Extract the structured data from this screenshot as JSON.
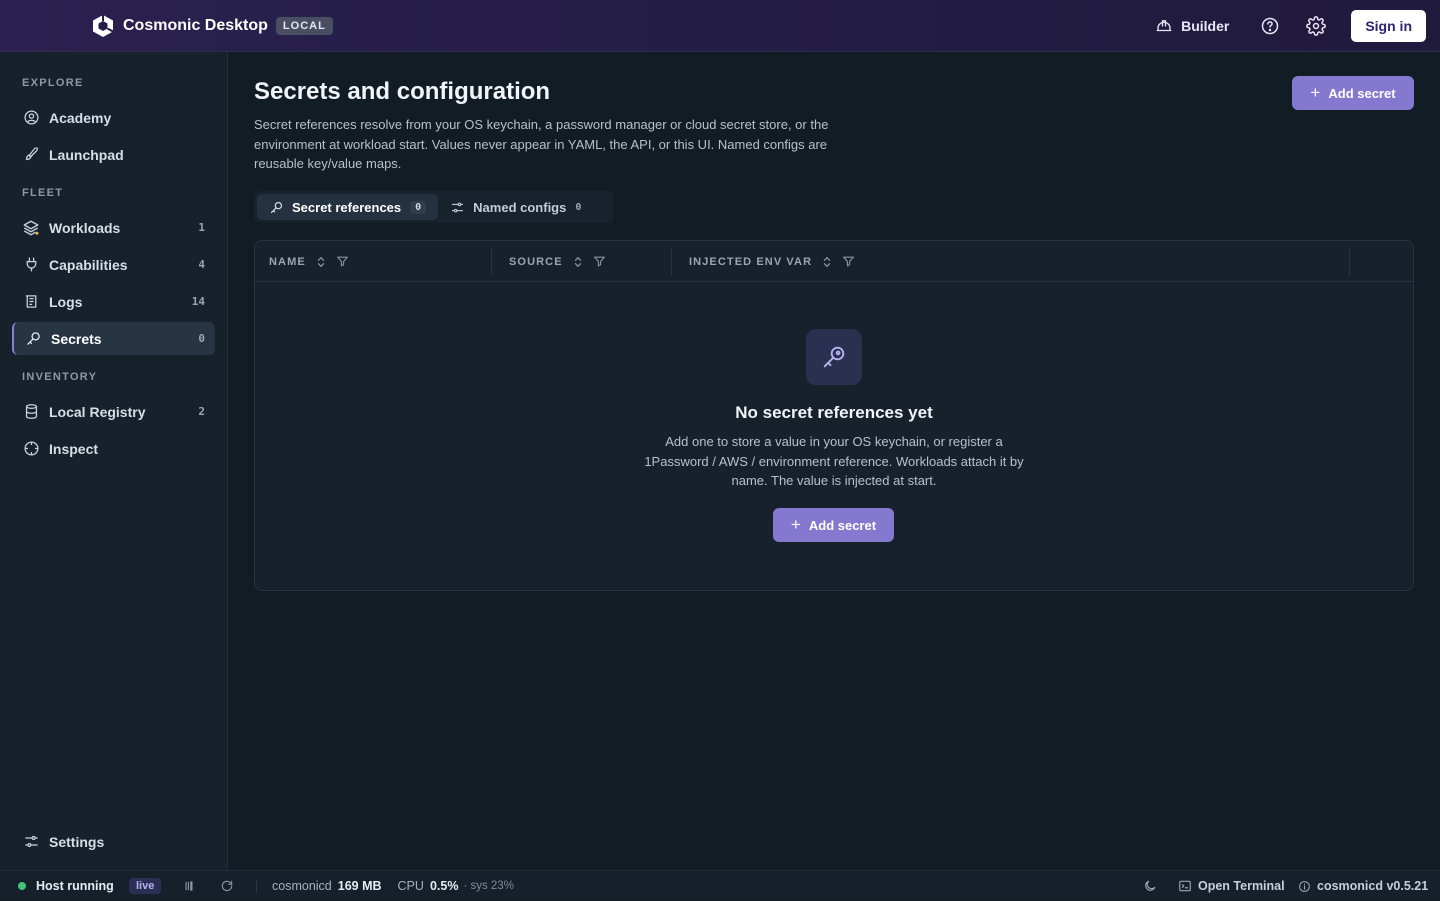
{
  "app": {
    "name": "Cosmonic Desktop",
    "env_badge": "LOCAL",
    "builder_label": "Builder",
    "signin_label": "Sign in"
  },
  "sidebar": {
    "sections": [
      {
        "title": "EXPLORE"
      },
      {
        "title": "FLEET"
      },
      {
        "title": "INVENTORY"
      }
    ],
    "items": [
      {
        "label": "Academy",
        "icon": "academy-icon"
      },
      {
        "label": "Launchpad",
        "icon": "rocket-icon"
      },
      {
        "label": "Workloads",
        "icon": "layers-icon",
        "count": "1"
      },
      {
        "label": "Capabilities",
        "icon": "plug-icon",
        "count": "4"
      },
      {
        "label": "Logs",
        "icon": "logs-icon",
        "count": "14"
      },
      {
        "label": "Secrets",
        "icon": "key-icon",
        "count": "0",
        "active": true
      },
      {
        "label": "Local Registry",
        "icon": "database-icon",
        "count": "2"
      },
      {
        "label": "Inspect",
        "icon": "inspect-icon"
      }
    ],
    "footer_label": "Settings"
  },
  "main": {
    "title": "Secrets and configuration",
    "description": "Secret references resolve from your OS keychain, a password manager or cloud secret store, or the environment at workload start. Values never appear in YAML, the API, or this UI. Named configs are reusable key/value maps.",
    "add_button_label": "Add secret",
    "tabs": [
      {
        "label": "Secret references",
        "count": "0",
        "active": true
      },
      {
        "label": "Named configs",
        "count": "0"
      }
    ],
    "table": {
      "columns": [
        "NAME",
        "SOURCE",
        "INJECTED ENV VAR"
      ],
      "rows": []
    },
    "empty_state": {
      "title": "No secret references yet",
      "description": "Add one to store a value in your OS keychain, or register a 1Password / AWS / environment reference. Workloads attach it by name. The value is injected at start.",
      "button_label": "Add secret"
    }
  },
  "statusbar": {
    "host_status": "Host running",
    "live_badge": "live",
    "process_name": "cosmonicd",
    "memory": "169 MB",
    "cpu_label": "CPU",
    "cpu_value": "0.5%",
    "sys_value": "· sys 23%",
    "open_terminal_label": "Open Terminal",
    "version": "cosmonicd v0.5.21"
  },
  "colors": {
    "accent": "#8578cf",
    "status_ok": "#3fc37a",
    "topbar_bg": "#241d45",
    "sidebar_bg": "#17212b",
    "main_bg": "#121c24"
  }
}
